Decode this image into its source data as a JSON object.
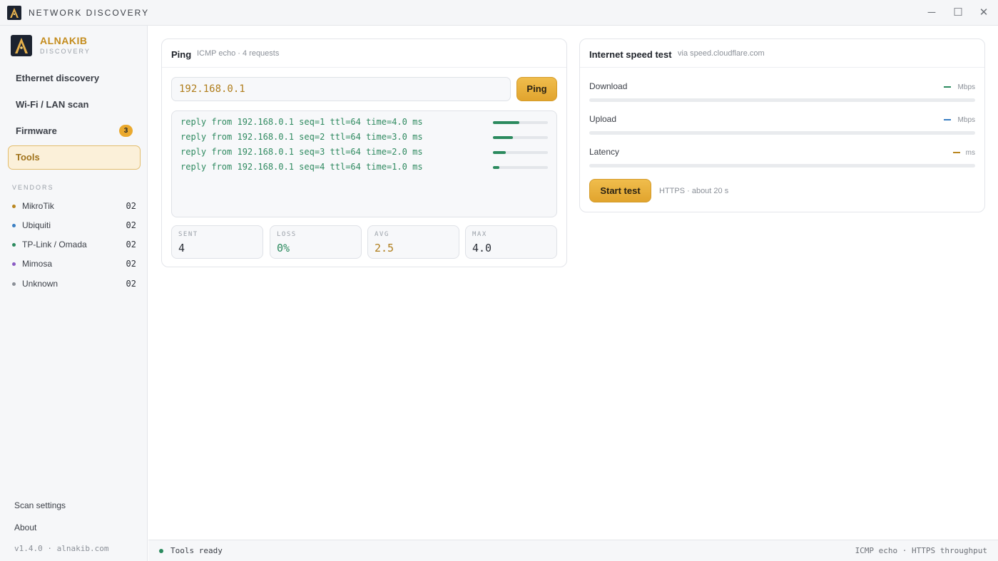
{
  "window": {
    "title": "NETWORK DISCOVERY",
    "minimize": "─",
    "maximize": "☐",
    "close": "✕"
  },
  "brand": {
    "name": "ALNAKIB",
    "subtitle": "DISCOVERY"
  },
  "nav": [
    {
      "label": "Ethernet discovery"
    },
    {
      "label": "Wi-Fi / LAN scan"
    },
    {
      "label": "Firmware",
      "badge": "3"
    },
    {
      "label": "Tools",
      "active": true
    }
  ],
  "vendors_heading": "VENDORS",
  "vendors": [
    {
      "name": "MikroTik",
      "count": "02",
      "color": "#b9861f"
    },
    {
      "name": "Ubiquiti",
      "count": "02",
      "color": "#3a7fc3"
    },
    {
      "name": "TP-Link / Omada",
      "count": "02",
      "color": "#2b8a5e"
    },
    {
      "name": "Mimosa",
      "count": "02",
      "color": "#8a5bc4"
    },
    {
      "name": "Unknown",
      "count": "02",
      "color": "#8b9098"
    }
  ],
  "sidebar_footer": {
    "scan_settings": "Scan settings",
    "about": "About",
    "version": "v1.4.0 · alnakib.com"
  },
  "ping": {
    "title": "Ping",
    "subtitle": "ICMP echo · 4 requests",
    "target": "192.168.0.1",
    "button": "Ping",
    "replies": [
      {
        "text": "reply from 192.168.0.1 seq=1 ttl=64 time=4.0 ms",
        "fill": 0.48
      },
      {
        "text": "reply from 192.168.0.1 seq=2 ttl=64 time=3.0 ms",
        "fill": 0.36
      },
      {
        "text": "reply from 192.168.0.1 seq=3 ttl=64 time=2.0 ms",
        "fill": 0.24
      },
      {
        "text": "reply from 192.168.0.1 seq=4 ttl=64 time=1.0 ms",
        "fill": 0.12
      }
    ],
    "stats": [
      {
        "label": "SENT",
        "value": "4",
        "color": "#2c3038"
      },
      {
        "label": "LOSS",
        "value": "0%",
        "color": "#2b8a5e"
      },
      {
        "label": "AVG",
        "value": "2.5",
        "color": "#b07e1c"
      },
      {
        "label": "MAX",
        "value": "4.0",
        "color": "#2c3038"
      }
    ]
  },
  "speedtest": {
    "title": "Internet speed test",
    "subtitle": "via speed.cloudflare.com",
    "metrics": [
      {
        "label": "Download",
        "unit": "Mbps",
        "color": "#2b8a5e"
      },
      {
        "label": "Upload",
        "unit": "Mbps",
        "color": "#3a7fc3"
      },
      {
        "label": "Latency",
        "unit": "ms",
        "color": "#b9861f"
      }
    ],
    "button": "Start test",
    "note": "HTTPS · about 20 s"
  },
  "statusbar": {
    "left": "Tools ready",
    "right": "ICMP echo · HTTPS throughput"
  }
}
